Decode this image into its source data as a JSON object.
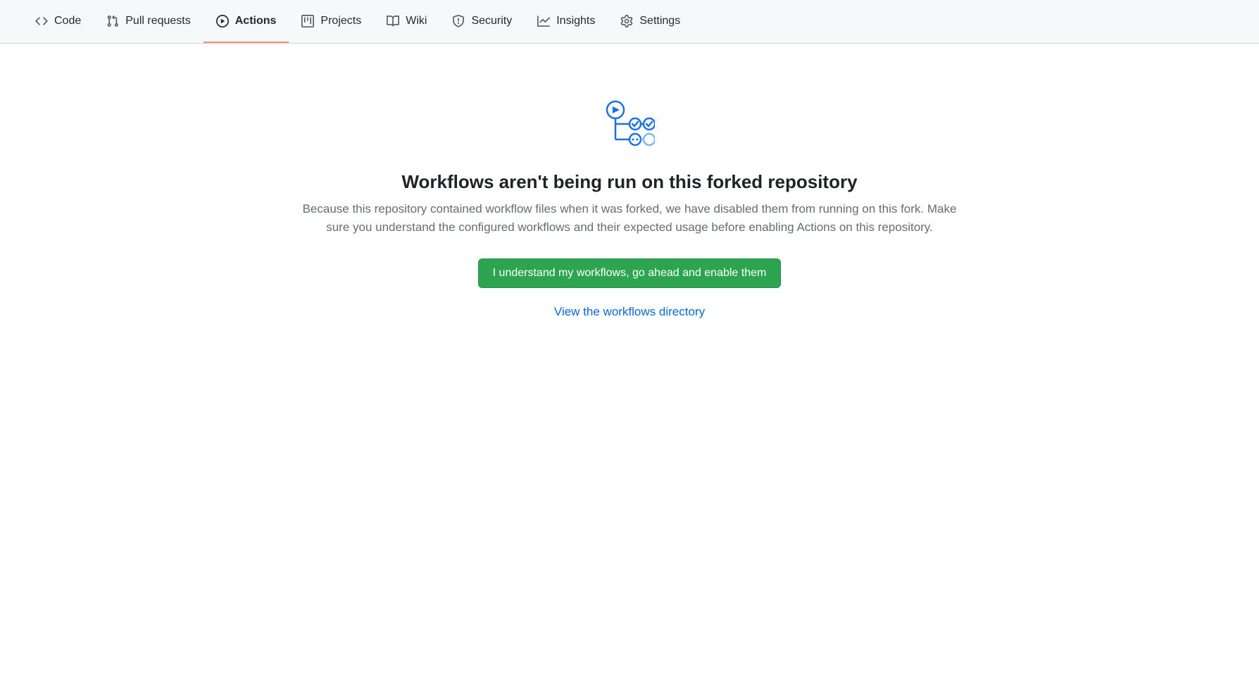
{
  "tabs": {
    "code": "Code",
    "pull_requests": "Pull requests",
    "actions": "Actions",
    "projects": "Projects",
    "wiki": "Wiki",
    "security": "Security",
    "insights": "Insights",
    "settings": "Settings"
  },
  "blankslate": {
    "heading": "Workflows aren't being run on this forked repository",
    "description": "Because this repository contained workflow files when it was forked, we have disabled them from running on this fork. Make sure you understand the configured workflows and their expected usage before enabling Actions on this repository.",
    "primary_button": "I understand my workflows, go ahead and enable them",
    "secondary_link": "View the workflows directory"
  }
}
